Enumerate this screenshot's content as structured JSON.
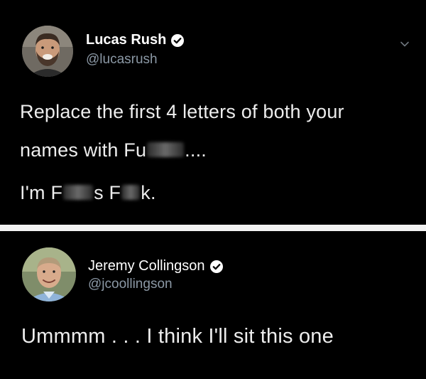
{
  "tweet1": {
    "display_name": "Lucas Rush",
    "handle": "@lucasrush",
    "text_line1": "Replace the first 4 letters of both your",
    "text_line2_a": "names with Fu",
    "text_line2_b": "....",
    "text_line3_a": "I'm F",
    "text_line3_b": "s F",
    "text_line3_c": "k.",
    "icons": [
      "verified-badge-icon",
      "chevron-down-icon"
    ]
  },
  "tweet2": {
    "display_name": "Jeremy Collingson",
    "handle": "@jcoollingson",
    "text_line1": "Ummmm . . . I think I'll sit this one",
    "icons": [
      "verified-badge-icon"
    ]
  },
  "colors": {
    "background": "#000000",
    "text": "#ededed",
    "handle": "#8b98a5",
    "divider": "#f2f2f2",
    "verified": "#ffffff"
  }
}
